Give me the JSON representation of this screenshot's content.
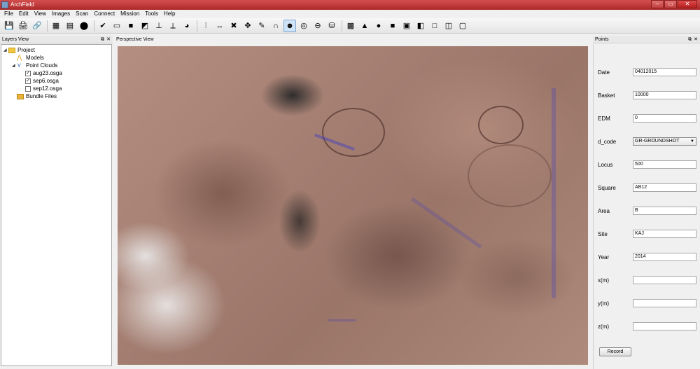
{
  "window": {
    "title": "ArchField",
    "buttons": {
      "minimize": "–",
      "maximize": "▭",
      "close": "✕"
    }
  },
  "menubar": [
    "File",
    "Edit",
    "View",
    "Images",
    "Scan",
    "Connect",
    "Mission",
    "Tools",
    "Help"
  ],
  "toolbar": {
    "buttons": [
      {
        "name": "save-icon",
        "glyph": "💾"
      },
      {
        "name": "print-icon",
        "glyph": "🖨"
      },
      {
        "name": "link-icon",
        "glyph": "🔗"
      },
      {
        "name": "sep"
      },
      {
        "name": "grid-icon",
        "glyph": "▦"
      },
      {
        "name": "scan-icon",
        "glyph": "▤"
      },
      {
        "name": "stop-icon",
        "glyph": "⬤"
      },
      {
        "name": "sep"
      },
      {
        "name": "check-icon",
        "glyph": "✔"
      },
      {
        "name": "battery-icon",
        "glyph": "▭"
      },
      {
        "name": "cube-icon",
        "glyph": "■"
      },
      {
        "name": "layers-icon",
        "glyph": "◩"
      },
      {
        "name": "axis-icon",
        "glyph": "⊥"
      },
      {
        "name": "axes-3d-icon",
        "glyph": "⟂"
      },
      {
        "name": "pie-icon",
        "glyph": "◕"
      },
      {
        "name": "sep"
      },
      {
        "name": "sliders-icon",
        "glyph": "⫶"
      },
      {
        "name": "measure-icon",
        "glyph": "↔"
      },
      {
        "name": "cross-icon",
        "glyph": "✖"
      },
      {
        "name": "move-icon",
        "glyph": "✥"
      },
      {
        "name": "pencil-icon",
        "glyph": "✎"
      },
      {
        "name": "magnet-icon",
        "glyph": "∩"
      },
      {
        "name": "user-icon",
        "glyph": "☻"
      },
      {
        "name": "target-icon",
        "glyph": "◎"
      },
      {
        "name": "minus-icon",
        "glyph": "⊖"
      },
      {
        "name": "database-icon",
        "glyph": "⛁"
      },
      {
        "name": "sep"
      },
      {
        "name": "texture-icon",
        "glyph": "▩"
      },
      {
        "name": "terrain-icon",
        "glyph": "▲"
      },
      {
        "name": "sphere-icon",
        "glyph": "●"
      },
      {
        "name": "box-blue-icon",
        "glyph": "■"
      },
      {
        "name": "box-front-icon",
        "glyph": "▣"
      },
      {
        "name": "box-side-icon",
        "glyph": "◧"
      },
      {
        "name": "box-outline-icon",
        "glyph": "□"
      },
      {
        "name": "box-wire-icon",
        "glyph": "◫"
      },
      {
        "name": "box-top-icon",
        "glyph": "▢"
      }
    ],
    "active_index": 22
  },
  "layers_view": {
    "title": "Layers View",
    "tree": [
      {
        "label": "Project",
        "level": 0,
        "icon": "folder",
        "toggle": "◢"
      },
      {
        "label": "Models",
        "level": 1,
        "icon": "models"
      },
      {
        "label": "Point Clouds",
        "level": 1,
        "icon": "cloud",
        "toggle": "◢"
      },
      {
        "label": "aug23.osga",
        "level": 2,
        "checkbox": true,
        "checked": true
      },
      {
        "label": "sep6.osga",
        "level": 2,
        "checkbox": true,
        "checked": true
      },
      {
        "label": "sep12.osga",
        "level": 2,
        "checkbox": true,
        "checked": false
      },
      {
        "label": "Bundle Files",
        "level": 1,
        "icon": "bundle"
      }
    ]
  },
  "perspective_view": {
    "title": "Perspective View"
  },
  "points": {
    "title": "Points",
    "fields": [
      {
        "label": "Date",
        "value": "04012015",
        "type": "text"
      },
      {
        "label": "Basket",
        "value": "10000",
        "type": "text"
      },
      {
        "label": "EDM",
        "value": "0",
        "type": "text"
      },
      {
        "label": "d_code",
        "value": "GR-GROUNDSHOT",
        "type": "select"
      },
      {
        "label": "Locus",
        "value": "500",
        "type": "text"
      },
      {
        "label": "Square",
        "value": "AB12",
        "type": "text"
      },
      {
        "label": "Area",
        "value": "B",
        "type": "text"
      },
      {
        "label": "Site",
        "value": "KAJ",
        "type": "text"
      },
      {
        "label": "Year",
        "value": "2014",
        "type": "text"
      },
      {
        "label": "x(m)",
        "value": "",
        "type": "text"
      },
      {
        "label": "y(m)",
        "value": "",
        "type": "text"
      },
      {
        "label": "z(m)",
        "value": "",
        "type": "text"
      }
    ],
    "record_label": "Record"
  },
  "colors": {
    "titlebar": "#c03a3a",
    "active_toolbar": "#cfe3f7",
    "point_overlay": "#3c3cc8"
  }
}
